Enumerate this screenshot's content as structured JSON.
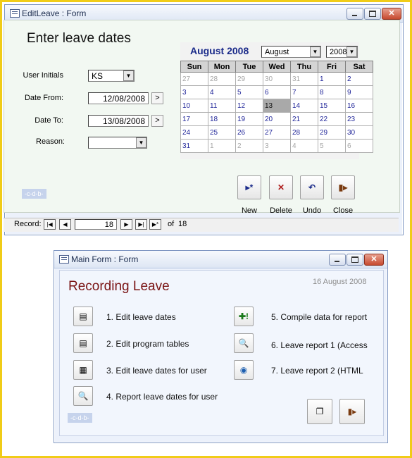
{
  "edit_window": {
    "title": "EditLeave : Form",
    "heading": "Enter leave dates",
    "user_initials": {
      "label": "User Initials",
      "value": "KS"
    },
    "date_from": {
      "label": "Date From:",
      "value": "12/08/2008",
      "button": ">"
    },
    "date_to": {
      "label": "Date To:",
      "value": "13/08/2008",
      "button": ">"
    },
    "reason": {
      "label": "Reason:",
      "value": ""
    },
    "calendar": {
      "title": "August 2008",
      "month_select": "August",
      "year_select": "2008",
      "weekdays": [
        "Sun",
        "Mon",
        "Tue",
        "Wed",
        "Thu",
        "Fri",
        "Sat"
      ],
      "selected_day": "13",
      "weeks": [
        [
          "27",
          "28",
          "29",
          "30",
          "31",
          "1",
          "2"
        ],
        [
          "3",
          "4",
          "5",
          "6",
          "7",
          "8",
          "9"
        ],
        [
          "10",
          "11",
          "12",
          "13",
          "14",
          "15",
          "16"
        ],
        [
          "17",
          "18",
          "19",
          "20",
          "21",
          "22",
          "23"
        ],
        [
          "24",
          "25",
          "26",
          "27",
          "28",
          "29",
          "30"
        ],
        [
          "31",
          "1",
          "2",
          "3",
          "4",
          "5",
          "6"
        ]
      ]
    },
    "actions": {
      "new": "New",
      "delete": "Delete",
      "undo": "Undo",
      "close": "Close"
    },
    "tag": "-c-d-b-",
    "record_nav": {
      "label": "Record:",
      "current": "18",
      "of_label": "of",
      "total": "18"
    }
  },
  "main_window": {
    "title": "Main Form : Form",
    "heading": "Recording Leave",
    "date": "16 August 2008",
    "items": {
      "i1": "1. Edit leave dates",
      "i2": "2. Edit program tables",
      "i3": "3. Edit leave dates for user",
      "i4": "4. Report leave dates for user",
      "i5": "5. Compile data for report",
      "i6": "6. Leave report 1 (Access",
      "i7": "7. Leave report 2 (HTML"
    },
    "tag": "-c-d-b-"
  },
  "colors": {
    "frame": "#f0cc18",
    "heading_main": "#7a1414",
    "calendar_title": "#1b2b8a"
  }
}
